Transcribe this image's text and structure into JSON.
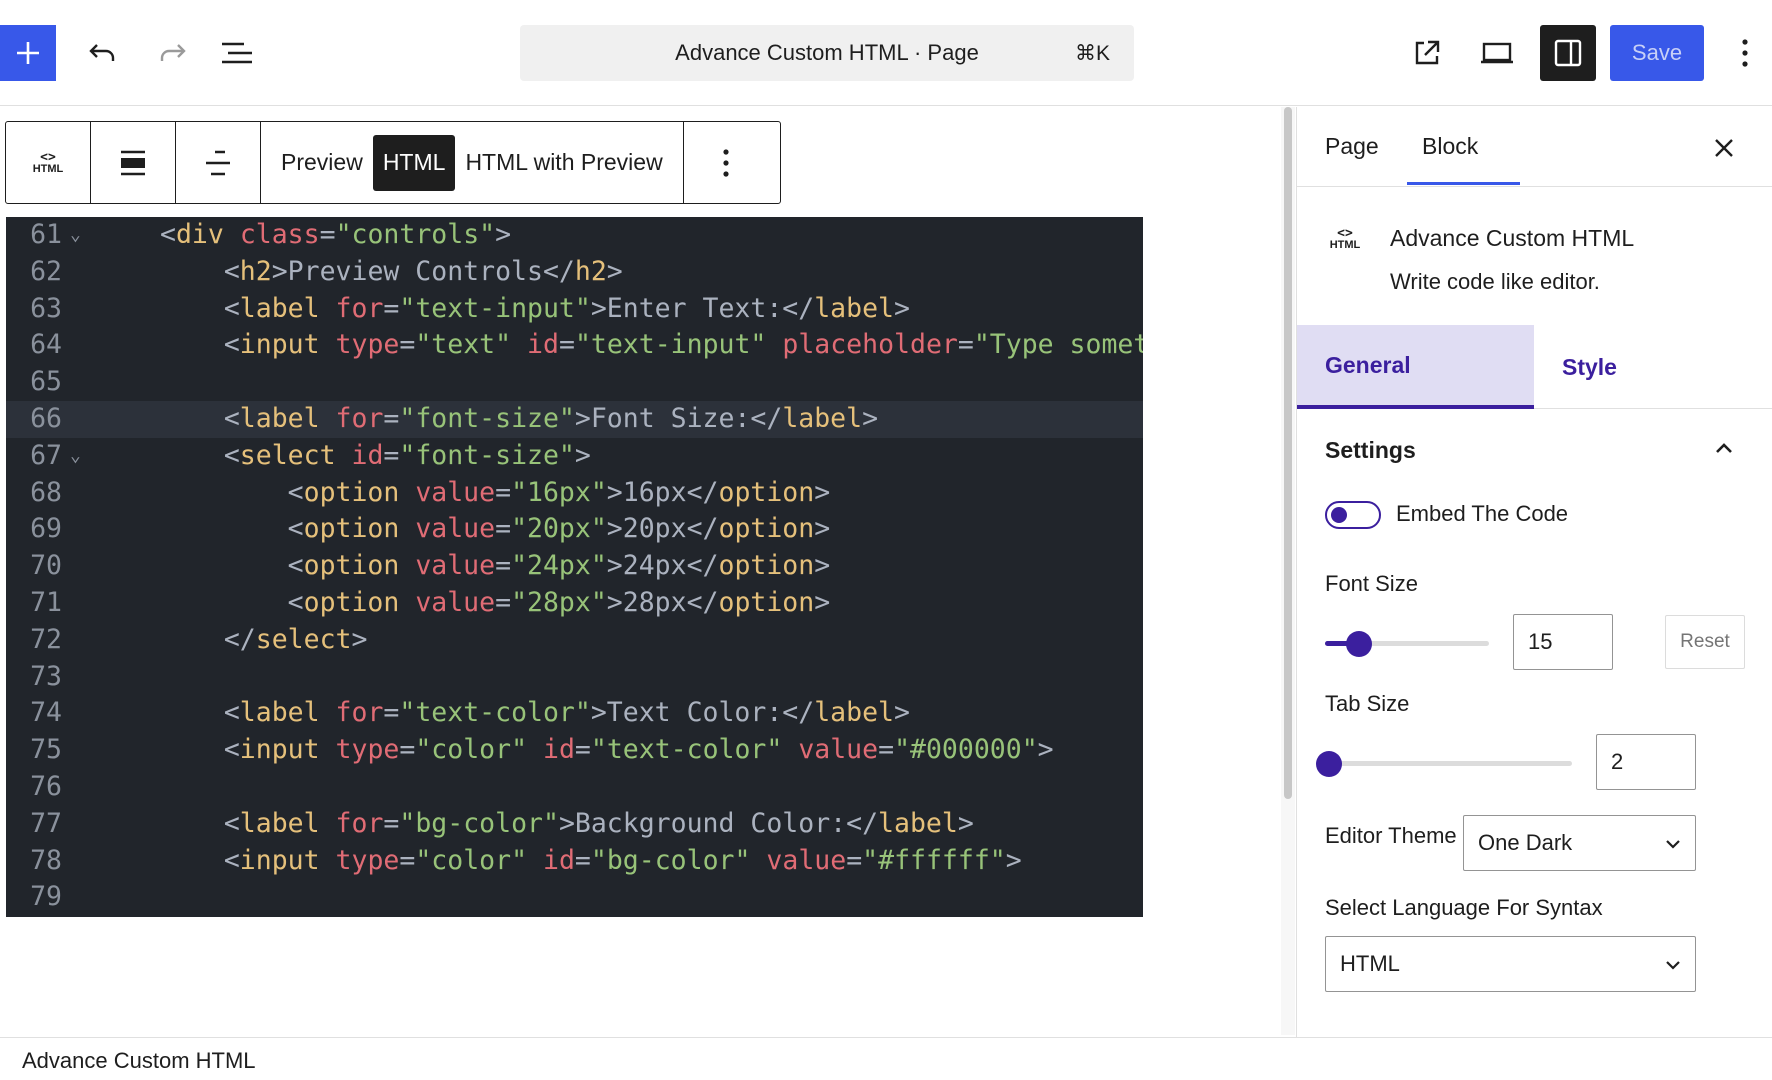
{
  "header": {
    "document_title": "Advance Custom HTML · Page",
    "shortcut": "⌘K",
    "save_label": "Save"
  },
  "block_toolbar": {
    "block_icon_label": "HTML",
    "modes": [
      "Preview",
      "HTML",
      "HTML with Preview"
    ],
    "active_mode": "HTML"
  },
  "editor": {
    "lines": [
      {
        "num": "61",
        "fold": true,
        "indent": 0,
        "tokens": [
          [
            "p",
            "<"
          ],
          [
            "g",
            "div"
          ],
          [
            "p",
            " "
          ],
          [
            "a",
            "class"
          ],
          [
            "p",
            "="
          ],
          [
            "s",
            "\"controls\""
          ],
          [
            "p",
            ">"
          ]
        ]
      },
      {
        "num": "62",
        "fold": false,
        "indent": 1,
        "tokens": [
          [
            "p",
            "<"
          ],
          [
            "g",
            "h2"
          ],
          [
            "p",
            ">Preview Controls</"
          ],
          [
            "g",
            "h2"
          ],
          [
            "p",
            ">"
          ]
        ]
      },
      {
        "num": "63",
        "fold": false,
        "indent": 1,
        "tokens": [
          [
            "p",
            "<"
          ],
          [
            "g",
            "label"
          ],
          [
            "p",
            " "
          ],
          [
            "a",
            "for"
          ],
          [
            "p",
            "="
          ],
          [
            "s",
            "\"text-input\""
          ],
          [
            "p",
            ">Enter Text:</"
          ],
          [
            "g",
            "label"
          ],
          [
            "p",
            ">"
          ]
        ]
      },
      {
        "num": "64",
        "fold": false,
        "indent": 1,
        "tokens": [
          [
            "p",
            "<"
          ],
          [
            "g",
            "input"
          ],
          [
            "p",
            " "
          ],
          [
            "a",
            "type"
          ],
          [
            "p",
            "="
          ],
          [
            "s",
            "\"text\""
          ],
          [
            "p",
            " "
          ],
          [
            "a",
            "id"
          ],
          [
            "p",
            "="
          ],
          [
            "s",
            "\"text-input\""
          ],
          [
            "p",
            " "
          ],
          [
            "a",
            "placeholder"
          ],
          [
            "p",
            "="
          ],
          [
            "s",
            "\"Type somet"
          ]
        ]
      },
      {
        "num": "65",
        "fold": false,
        "indent": 0,
        "tokens": []
      },
      {
        "num": "66",
        "fold": false,
        "indent": 1,
        "current": true,
        "tokens": [
          [
            "p",
            "<"
          ],
          [
            "g",
            "label"
          ],
          [
            "p",
            " "
          ],
          [
            "a",
            "for"
          ],
          [
            "p",
            "="
          ],
          [
            "s",
            "\"font-size\""
          ],
          [
            "p",
            ">Font Size:</"
          ],
          [
            "g",
            "label"
          ],
          [
            "p",
            ">"
          ]
        ]
      },
      {
        "num": "67",
        "fold": true,
        "indent": 1,
        "tokens": [
          [
            "p",
            "<"
          ],
          [
            "g",
            "select"
          ],
          [
            "p",
            " "
          ],
          [
            "a",
            "id"
          ],
          [
            "p",
            "="
          ],
          [
            "s",
            "\"font-size\""
          ],
          [
            "p",
            ">"
          ]
        ]
      },
      {
        "num": "68",
        "fold": false,
        "indent": 2,
        "tokens": [
          [
            "p",
            "<"
          ],
          [
            "g",
            "option"
          ],
          [
            "p",
            " "
          ],
          [
            "a",
            "value"
          ],
          [
            "p",
            "="
          ],
          [
            "s",
            "\"16px\""
          ],
          [
            "p",
            ">16px</"
          ],
          [
            "g",
            "option"
          ],
          [
            "p",
            ">"
          ]
        ]
      },
      {
        "num": "69",
        "fold": false,
        "indent": 2,
        "tokens": [
          [
            "p",
            "<"
          ],
          [
            "g",
            "option"
          ],
          [
            "p",
            " "
          ],
          [
            "a",
            "value"
          ],
          [
            "p",
            "="
          ],
          [
            "s",
            "\"20px\""
          ],
          [
            "p",
            ">20px</"
          ],
          [
            "g",
            "option"
          ],
          [
            "p",
            ">"
          ]
        ]
      },
      {
        "num": "70",
        "fold": false,
        "indent": 2,
        "tokens": [
          [
            "p",
            "<"
          ],
          [
            "g",
            "option"
          ],
          [
            "p",
            " "
          ],
          [
            "a",
            "value"
          ],
          [
            "p",
            "="
          ],
          [
            "s",
            "\"24px\""
          ],
          [
            "p",
            ">24px</"
          ],
          [
            "g",
            "option"
          ],
          [
            "p",
            ">"
          ]
        ]
      },
      {
        "num": "71",
        "fold": false,
        "indent": 2,
        "tokens": [
          [
            "p",
            "<"
          ],
          [
            "g",
            "option"
          ],
          [
            "p",
            " "
          ],
          [
            "a",
            "value"
          ],
          [
            "p",
            "="
          ],
          [
            "s",
            "\"28px\""
          ],
          [
            "p",
            ">28px</"
          ],
          [
            "g",
            "option"
          ],
          [
            "p",
            ">"
          ]
        ]
      },
      {
        "num": "72",
        "fold": false,
        "indent": 1,
        "tokens": [
          [
            "p",
            "</"
          ],
          [
            "g",
            "select"
          ],
          [
            "p",
            ">"
          ]
        ]
      },
      {
        "num": "73",
        "fold": false,
        "indent": 0,
        "tokens": []
      },
      {
        "num": "74",
        "fold": false,
        "indent": 1,
        "tokens": [
          [
            "p",
            "<"
          ],
          [
            "g",
            "label"
          ],
          [
            "p",
            " "
          ],
          [
            "a",
            "for"
          ],
          [
            "p",
            "="
          ],
          [
            "s",
            "\"text-color\""
          ],
          [
            "p",
            ">Text Color:</"
          ],
          [
            "g",
            "label"
          ],
          [
            "p",
            ">"
          ]
        ]
      },
      {
        "num": "75",
        "fold": false,
        "indent": 1,
        "tokens": [
          [
            "p",
            "<"
          ],
          [
            "g",
            "input"
          ],
          [
            "p",
            " "
          ],
          [
            "a",
            "type"
          ],
          [
            "p",
            "="
          ],
          [
            "s",
            "\"color\""
          ],
          [
            "p",
            " "
          ],
          [
            "a",
            "id"
          ],
          [
            "p",
            "="
          ],
          [
            "s",
            "\"text-color\""
          ],
          [
            "p",
            " "
          ],
          [
            "a",
            "value"
          ],
          [
            "p",
            "="
          ],
          [
            "s",
            "\"#000000\""
          ],
          [
            "p",
            ">"
          ]
        ]
      },
      {
        "num": "76",
        "fold": false,
        "indent": 0,
        "tokens": []
      },
      {
        "num": "77",
        "fold": false,
        "indent": 1,
        "tokens": [
          [
            "p",
            "<"
          ],
          [
            "g",
            "label"
          ],
          [
            "p",
            " "
          ],
          [
            "a",
            "for"
          ],
          [
            "p",
            "="
          ],
          [
            "s",
            "\"bg-color\""
          ],
          [
            "p",
            ">Background Color:</"
          ],
          [
            "g",
            "label"
          ],
          [
            "p",
            ">"
          ]
        ]
      },
      {
        "num": "78",
        "fold": false,
        "indent": 1,
        "tokens": [
          [
            "p",
            "<"
          ],
          [
            "g",
            "input"
          ],
          [
            "p",
            " "
          ],
          [
            "a",
            "type"
          ],
          [
            "p",
            "="
          ],
          [
            "s",
            "\"color\""
          ],
          [
            "p",
            " "
          ],
          [
            "a",
            "id"
          ],
          [
            "p",
            "="
          ],
          [
            "s",
            "\"bg-color\""
          ],
          [
            "p",
            " "
          ],
          [
            "a",
            "value"
          ],
          [
            "p",
            "="
          ],
          [
            "s",
            "\"#ffffff\""
          ],
          [
            "p",
            ">"
          ]
        ]
      },
      {
        "num": "79",
        "fold": false,
        "indent": 0,
        "tokens": []
      }
    ]
  },
  "footer": {
    "breadcrumb": "Advance Custom HTML"
  },
  "sidebar": {
    "tabs": [
      "Page",
      "Block"
    ],
    "active_tab": "Block",
    "block_icon_label": "HTML",
    "block_title": "Advance Custom HTML",
    "block_description": "Write code like editor.",
    "inner_tabs": [
      "General",
      "Style"
    ],
    "active_inner_tab": "General",
    "settings_title": "Settings",
    "embed_label": "Embed The Code",
    "embed_enabled": false,
    "font_size_label": "Font Size",
    "font_size_value": "15",
    "font_size_fraction": 0.18,
    "reset_label": "Reset",
    "tab_size_label": "Tab Size",
    "tab_size_value": "2",
    "tab_size_fraction": 0.0,
    "editor_theme_label": "Editor Theme",
    "editor_theme_value": "One Dark",
    "syntax_label": "Select Language For Syntax",
    "syntax_value": "HTML"
  },
  "colors": {
    "accent": "#3858e9",
    "plugin_purple": "#3b1f9e",
    "editor_bg": "#21252b",
    "tag": "#e5c07b",
    "attr": "#e06c75",
    "string": "#98c379",
    "punct": "#abb2bf"
  },
  "icons": {
    "topbar": [
      "plus-icon",
      "undo-icon",
      "redo-icon",
      "list-view-icon",
      "external-link-icon",
      "desktop-preview-icon",
      "sidebar-icon",
      "more-vertical-icon"
    ],
    "toolbar": [
      "html-block-icon",
      "align-wide-icon",
      "justify-icon",
      "more-vertical-icon"
    ]
  }
}
